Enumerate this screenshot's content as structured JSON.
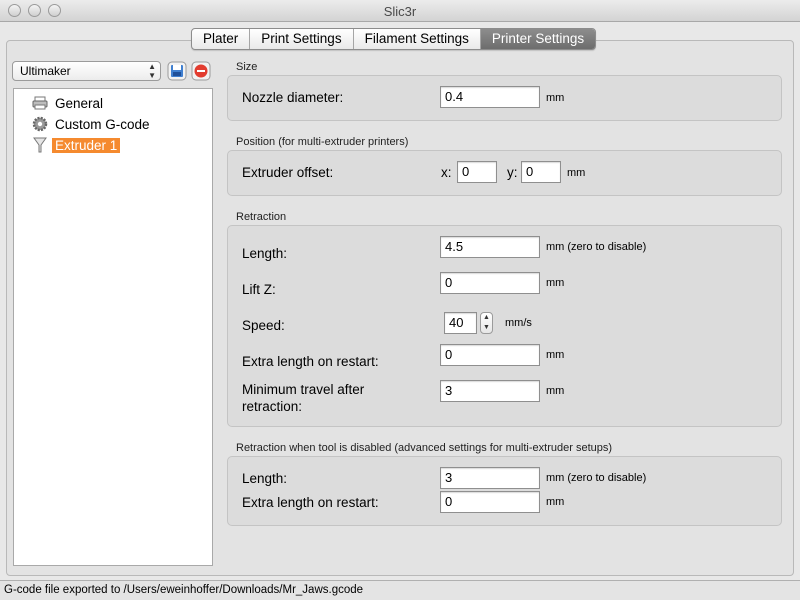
{
  "window": {
    "title": "Slic3r"
  },
  "tabs": [
    {
      "label": "Plater",
      "active": false
    },
    {
      "label": "Print Settings",
      "active": false
    },
    {
      "label": "Filament Settings",
      "active": false
    },
    {
      "label": "Printer Settings",
      "active": true
    }
  ],
  "sidebar": {
    "preset": "Ultimaker",
    "items": [
      {
        "label": "General",
        "icon": "printer-icon"
      },
      {
        "label": "Custom G-code",
        "icon": "cog-icon"
      },
      {
        "label": "Extruder 1",
        "icon": "funnel-icon",
        "selected": true
      }
    ]
  },
  "sections": {
    "size": {
      "title": "Size",
      "nozzle_label": "Nozzle diameter:",
      "nozzle_value": "0.4",
      "nozzle_unit": "mm"
    },
    "position": {
      "title": "Position (for multi-extruder printers)",
      "offset_label": "Extruder offset:",
      "x_label": "x:",
      "x_value": "0",
      "y_label": "y:",
      "y_value": "0",
      "unit": "mm"
    },
    "retraction": {
      "title": "Retraction",
      "length_label": "Length:",
      "length_value": "4.5",
      "length_unit": "mm (zero to disable)",
      "liftz_label": "Lift Z:",
      "liftz_value": "0",
      "liftz_unit": "mm",
      "speed_label": "Speed:",
      "speed_value": "40",
      "speed_unit": "mm/s",
      "extra_label": "Extra length on restart:",
      "extra_value": "0",
      "extra_unit": "mm",
      "travel_label_1": "Minimum travel after",
      "travel_label_2": "retraction:",
      "travel_value": "3",
      "travel_unit": "mm"
    },
    "retraction_disabled": {
      "title": "Retraction when tool is disabled (advanced settings for multi-extruder setups)",
      "length_label": "Length:",
      "length_value": "3",
      "length_unit": "mm (zero to disable)",
      "extra_label": "Extra length on restart:",
      "extra_value": "0",
      "extra_unit": "mm"
    }
  },
  "status": "G-code file exported to /Users/eweinhoffer/Downloads/Mr_Jaws.gcode",
  "colors": {
    "selection": "#f58a2f",
    "active_tab": "#7a7a7a"
  }
}
